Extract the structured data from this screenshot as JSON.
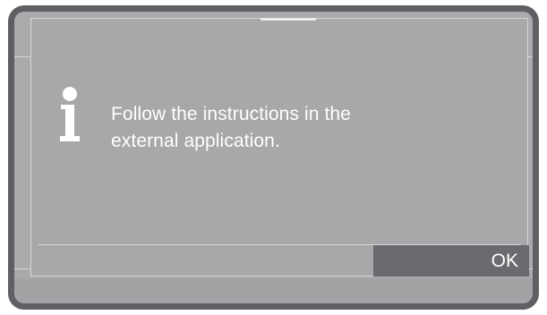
{
  "dialog": {
    "icon": "info-icon",
    "message_line1": "Follow the instructions in the",
    "message_line2": "external application.",
    "ok_label": "OK"
  },
  "colors": {
    "frame": "#5f6063",
    "screen": "#a9aaac",
    "button": "#6a6b6e",
    "text": "#ffffff"
  }
}
